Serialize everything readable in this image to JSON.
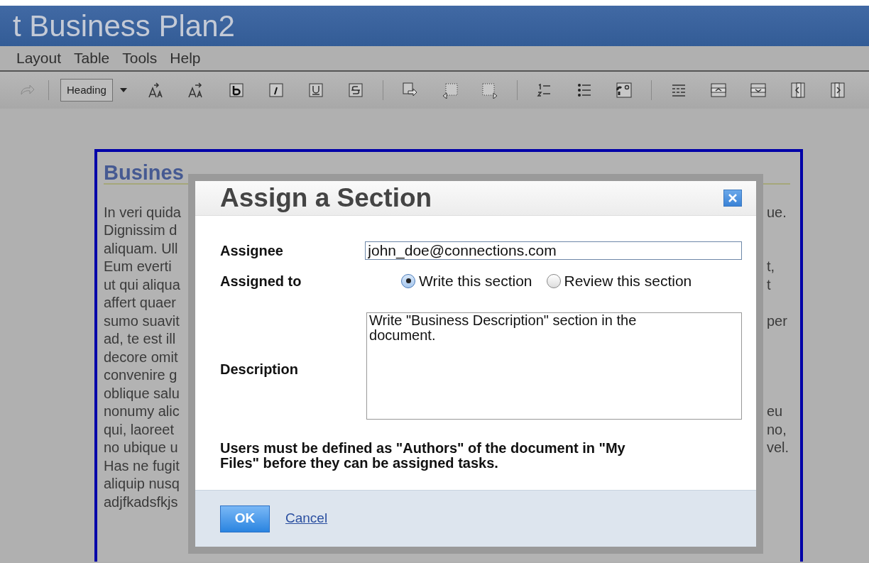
{
  "window": {
    "title": "t Business Plan2"
  },
  "menu": [
    {
      "label": "Layout"
    },
    {
      "label": "Table"
    },
    {
      "label": "Tools"
    },
    {
      "label": "Help"
    }
  ],
  "toolbar": {
    "style_select": "Heading"
  },
  "document": {
    "heading": "Busines",
    "lines": [
      {
        "left": "In veri quida",
        "right": "ue."
      },
      {
        "left": "Dignissim d"
      },
      {
        "left": "aliquam. Ull"
      },
      {
        "left": "Eum everti",
        "right": "t,"
      },
      {
        "left": "ut qui aliqua",
        "right": "t"
      },
      {
        "left": "affert quaer"
      },
      {
        "left": "sumo suavit",
        "right": "per"
      },
      {
        "left": "ad, te est ill"
      },
      {
        "left": "decore omit"
      },
      {
        "left": "convenire g"
      },
      {
        "left": "oblique salu"
      },
      {
        "left": "nonumy alic",
        "right": "eu"
      },
      {
        "left": "qui, laoreet",
        "right": "no,"
      },
      {
        "left": "no ubique u",
        "right": "vel."
      },
      {
        "left": "Has ne fugit"
      },
      {
        "left": "aliquip nusq"
      },
      {
        "left": "adjfkadsfkjs"
      }
    ]
  },
  "dialog": {
    "title": "Assign a Section",
    "fields": [
      {
        "kind": "text",
        "label": "Assignee",
        "value": "john_doe@connections.com"
      },
      {
        "kind": "radio",
        "label": "Assigned to",
        "options": [
          {
            "label": "Write this section",
            "selected": true
          },
          {
            "label": "Review this section",
            "selected": false
          }
        ]
      },
      {
        "kind": "textarea",
        "label": "Description",
        "value": "Write \"Business Description\" section in the document."
      }
    ],
    "note": "Users must be defined as \"Authors\" of the document in \"My Files\" before they can be assigned tasks.",
    "buttons": [
      {
        "kind": "primary",
        "label": "OK"
      },
      {
        "kind": "link",
        "label": "Cancel"
      }
    ]
  }
}
